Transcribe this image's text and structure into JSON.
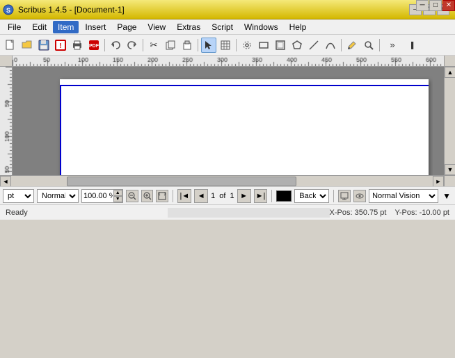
{
  "titlebar": {
    "title": "Scribus 1.4.5 - [Document-1]",
    "icon": "scribus-logo",
    "min_label": "─",
    "max_label": "□",
    "close_label": "✕",
    "restore_label": "❐"
  },
  "menubar": {
    "items": [
      {
        "label": "File",
        "id": "file"
      },
      {
        "label": "Edit",
        "id": "edit"
      },
      {
        "label": "Item",
        "id": "item"
      },
      {
        "label": "Insert",
        "id": "insert"
      },
      {
        "label": "Page",
        "id": "page"
      },
      {
        "label": "View",
        "id": "view"
      },
      {
        "label": "Extras",
        "id": "extras"
      },
      {
        "label": "Script",
        "id": "script"
      },
      {
        "label": "Windows",
        "id": "windows"
      },
      {
        "label": "Help",
        "id": "help"
      }
    ]
  },
  "toolbar": {
    "buttons": [
      {
        "icon": "📄",
        "label": "new",
        "name": "new-button"
      },
      {
        "icon": "📂",
        "label": "open",
        "name": "open-button"
      },
      {
        "icon": "💾",
        "label": "save",
        "name": "save-button"
      },
      {
        "icon": "⛔",
        "label": "preflight",
        "name": "preflight-button"
      },
      {
        "icon": "🖨",
        "label": "print",
        "name": "print-button"
      },
      {
        "icon": "📮",
        "label": "export-pdf",
        "name": "export-pdf-button"
      }
    ]
  },
  "bottom_toolbar": {
    "unit": "pt",
    "mode": "Normal",
    "zoom": "100.00 %",
    "page_current": "1",
    "page_of": "of",
    "page_total": "1",
    "color_label": "Back",
    "vision_mode": "Normal Vision",
    "status_ready": "Ready",
    "xpos": "X-Pos: 350.75 pt",
    "ypos": "Y-Pos: -10.00 pt"
  },
  "ruler": {
    "marks": [
      "0",
      "50",
      "100",
      "150",
      "200",
      "250",
      "300",
      "350",
      "400"
    ]
  }
}
